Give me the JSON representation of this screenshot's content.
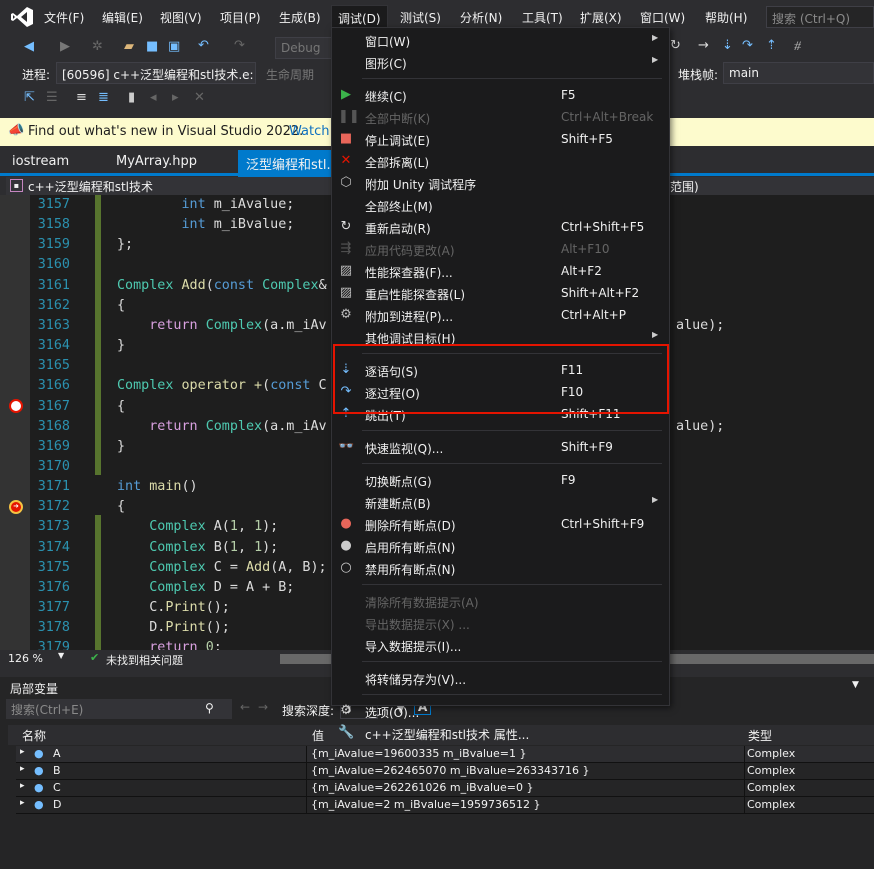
{
  "menubar": {
    "items": [
      "文件(F)",
      "编辑(E)",
      "视图(V)",
      "项目(P)",
      "生成(B)",
      "调试(D)",
      "测试(S)",
      "分析(N)",
      "工具(T)",
      "扩展(X)",
      "窗口(W)",
      "帮助(H)"
    ],
    "active": "调试(D)",
    "search_placeholder": "搜索 (Ctrl+Q)"
  },
  "toolbar": {
    "config": "Debug",
    "process_label": "进程:",
    "process_value": "[60596] c++泛型编程和stl技术.e:",
    "lifecycle_label": "生命周期",
    "stackframe_label": "堆栈帧:",
    "stackframe_value": "main"
  },
  "infobar": {
    "text": "Find out what's new in Visual Studio 2022.",
    "link": "Watch"
  },
  "tabs": [
    "iostream",
    "MyArray.hpp",
    "泛型编程和stl.cp"
  ],
  "navbar": {
    "project": "c++泛型编程和stl技术",
    "scope": "范围)"
  },
  "editor": {
    "lines": [
      {
        "n": "3157",
        "t": [
          [
            "        ",
            " "
          ],
          [
            "int",
            "kw"
          ],
          [
            " m_iAvalue;",
            ""
          ]
        ]
      },
      {
        "n": "3158",
        "t": [
          [
            "        ",
            ""
          ],
          [
            "int",
            "kw"
          ],
          [
            " m_iBvalue;",
            ""
          ]
        ]
      },
      {
        "n": "3159",
        "t": [
          [
            "};",
            ""
          ]
        ]
      },
      {
        "n": "3160",
        "t": []
      },
      {
        "n": "3161",
        "t": [
          [
            "Complex",
            "ty"
          ],
          [
            " ",
            ""
          ],
          [
            "Add",
            "fn"
          ],
          [
            "(",
            ""
          ],
          [
            "const",
            "kw"
          ],
          [
            " ",
            ""
          ],
          [
            "Complex",
            "ty"
          ],
          [
            "&",
            ""
          ]
        ]
      },
      {
        "n": "3162",
        "t": [
          [
            "{",
            ""
          ]
        ]
      },
      {
        "n": "3163",
        "t": [
          [
            "    ",
            ""
          ],
          [
            "return",
            "ctl"
          ],
          [
            " ",
            ""
          ],
          [
            "Complex",
            "ty"
          ],
          [
            "(a.m_iAv",
            ""
          ]
        ],
        "tail": "alue);"
      },
      {
        "n": "3164",
        "t": [
          [
            "}",
            ""
          ]
        ]
      },
      {
        "n": "3165",
        "t": []
      },
      {
        "n": "3166",
        "t": [
          [
            "Complex",
            "ty"
          ],
          [
            " ",
            ""
          ],
          [
            "operator +",
            "fn"
          ],
          [
            "(",
            ""
          ],
          [
            "const",
            "kw"
          ],
          [
            " C",
            ""
          ]
        ]
      },
      {
        "n": "3167",
        "t": [
          [
            "{",
            ""
          ]
        ]
      },
      {
        "n": "3168",
        "t": [
          [
            "    ",
            ""
          ],
          [
            "return",
            "ctl"
          ],
          [
            " ",
            ""
          ],
          [
            "Complex",
            "ty"
          ],
          [
            "(a.m_iAv",
            ""
          ]
        ],
        "tail": "alue);"
      },
      {
        "n": "3169",
        "t": [
          [
            "}",
            ""
          ]
        ]
      },
      {
        "n": "3170",
        "t": []
      },
      {
        "n": "3171",
        "t": [
          [
            "int",
            "kw"
          ],
          [
            " ",
            ""
          ],
          [
            "main",
            "fn"
          ],
          [
            "()",
            ""
          ]
        ]
      },
      {
        "n": "3172",
        "t": [
          [
            "{",
            ""
          ]
        ]
      },
      {
        "n": "3173",
        "t": [
          [
            "    ",
            ""
          ],
          [
            "Complex",
            "ty"
          ],
          [
            " A(",
            ""
          ],
          [
            "1",
            "nm"
          ],
          [
            ", ",
            ""
          ],
          [
            "1",
            "nm"
          ],
          [
            ");",
            ""
          ]
        ]
      },
      {
        "n": "3174",
        "t": [
          [
            "    ",
            ""
          ],
          [
            "Complex",
            "ty"
          ],
          [
            " B(",
            ""
          ],
          [
            "1",
            "nm"
          ],
          [
            ", ",
            ""
          ],
          [
            "1",
            "nm"
          ],
          [
            ");",
            ""
          ]
        ]
      },
      {
        "n": "3175",
        "t": [
          [
            "    ",
            ""
          ],
          [
            "Complex",
            "ty"
          ],
          [
            " C = ",
            ""
          ],
          [
            "Add",
            "fn"
          ],
          [
            "(A, B);",
            ""
          ]
        ]
      },
      {
        "n": "3176",
        "t": [
          [
            "    ",
            ""
          ],
          [
            "Complex",
            "ty"
          ],
          [
            " D = A + B;",
            ""
          ]
        ]
      },
      {
        "n": "3177",
        "t": [
          [
            "    C.",
            ""
          ],
          [
            "Print",
            "fn"
          ],
          [
            "();",
            ""
          ]
        ]
      },
      {
        "n": "3178",
        "t": [
          [
            "    D.",
            ""
          ],
          [
            "Print",
            "fn"
          ],
          [
            "();",
            ""
          ]
        ]
      },
      {
        "n": "3179",
        "t": [
          [
            "    ",
            ""
          ],
          [
            "return",
            "ctl"
          ],
          [
            " ",
            ""
          ],
          [
            "0",
            "nm"
          ],
          [
            ";",
            ""
          ]
        ]
      }
    ]
  },
  "status": {
    "zoom": "126 %",
    "issues": "未找到相关问题"
  },
  "locals": {
    "title": "局部变量",
    "search_placeholder": "搜索(Ctrl+E)",
    "depth_label": "搜索深度:",
    "depth_value": "3",
    "columns": [
      "名称",
      "值",
      "类型"
    ],
    "rows": [
      {
        "name": "A",
        "value": "{m_iAvalue=19600335 m_iBvalue=1 }",
        "type": "Complex"
      },
      {
        "name": "B",
        "value": "{m_iAvalue=262465070 m_iBvalue=263343716 }",
        "type": "Complex"
      },
      {
        "name": "C",
        "value": "{m_iAvalue=262261026 m_iBvalue=0 }",
        "type": "Complex"
      },
      {
        "name": "D",
        "value": "{m_iAvalue=2 m_iBvalue=1959736512 }",
        "type": "Complex"
      }
    ]
  },
  "debug_menu": {
    "items": [
      {
        "label": "窗口(W)",
        "submenu": true
      },
      {
        "label": "图形(C)",
        "submenu": true
      },
      {
        "sep": true
      },
      {
        "label": "继续(C)",
        "shortcut": "F5",
        "icon": "play-icon"
      },
      {
        "label": "全部中断(K)",
        "shortcut": "Ctrl+Alt+Break",
        "icon": "pause-icon",
        "disabled": true
      },
      {
        "label": "停止调试(E)",
        "shortcut": "Shift+F5",
        "icon": "stop-icon"
      },
      {
        "label": "全部拆离(L)",
        "icon": "detach-icon"
      },
      {
        "label": "附加 Unity 调试程序",
        "icon": "unity-icon"
      },
      {
        "label": "全部终止(M)"
      },
      {
        "label": "重新启动(R)",
        "shortcut": "Ctrl+Shift+F5",
        "icon": "restart-icon"
      },
      {
        "label": "应用代码更改(A)",
        "shortcut": "Alt+F10",
        "icon": "apply-code-icon",
        "disabled": true
      },
      {
        "label": "性能探查器(F)...",
        "shortcut": "Alt+F2",
        "icon": "profiler-icon"
      },
      {
        "label": "重启性能探查器(L)",
        "shortcut": "Shift+Alt+F2",
        "icon": "profiler-restart-icon"
      },
      {
        "label": "附加到进程(P)...",
        "shortcut": "Ctrl+Alt+P",
        "icon": "attach-icon"
      },
      {
        "label": "其他调试目标(H)",
        "submenu": true
      },
      {
        "sep": true
      },
      {
        "label": "逐语句(S)",
        "shortcut": "F11",
        "icon": "step-into-icon",
        "highlight": true
      },
      {
        "label": "逐过程(O)",
        "shortcut": "F10",
        "icon": "step-over-icon",
        "highlight": true
      },
      {
        "label": "跳出(T)",
        "shortcut": "Shift+F11",
        "icon": "step-out-icon",
        "highlight": true
      },
      {
        "sep": true
      },
      {
        "label": "快速监视(Q)...",
        "shortcut": "Shift+F9",
        "icon": "quickwatch-icon"
      },
      {
        "sep": true
      },
      {
        "label": "切换断点(G)",
        "shortcut": "F9"
      },
      {
        "label": "新建断点(B)",
        "submenu": true
      },
      {
        "label": "删除所有断点(D)",
        "shortcut": "Ctrl+Shift+F9",
        "icon": "delete-breakpoints-icon"
      },
      {
        "label": "启用所有断点(N)",
        "icon": "enable-breakpoints-icon"
      },
      {
        "label": "禁用所有断点(N)",
        "icon": "disable-breakpoints-icon"
      },
      {
        "sep": true
      },
      {
        "label": "清除所有数据提示(A)",
        "disabled": true
      },
      {
        "label": "导出数据提示(X) ...",
        "disabled": true
      },
      {
        "label": "导入数据提示(I)..."
      },
      {
        "sep": true
      },
      {
        "label": "将转储另存为(V)..."
      },
      {
        "sep": true
      },
      {
        "label": "选项(O)...",
        "icon": "gear-icon"
      },
      {
        "label": "c++泛型编程和stl技术 属性...",
        "icon": "wrench-icon"
      }
    ]
  },
  "colors": {
    "accent": "#007acc",
    "highlight_box": "#e51400",
    "infobar": "#fdfbcd"
  }
}
